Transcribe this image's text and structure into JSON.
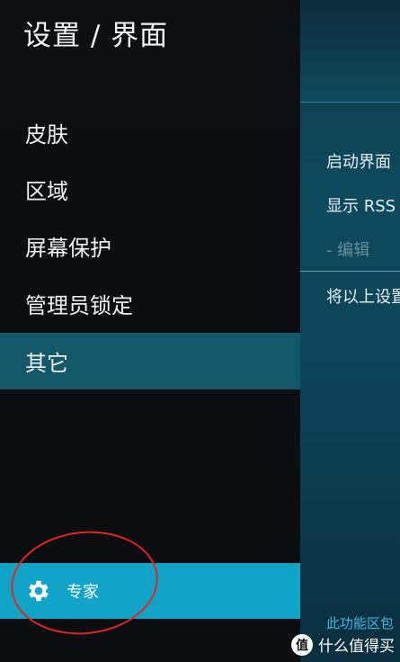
{
  "header": {
    "title": "设置 / 界面"
  },
  "menu": {
    "items": [
      {
        "label": "皮肤"
      },
      {
        "label": "区域"
      },
      {
        "label": "屏幕保护"
      },
      {
        "label": "管理员锁定"
      },
      {
        "label": "其它",
        "active": true
      }
    ]
  },
  "expert": {
    "label": "专家",
    "icon": "gear-icon"
  },
  "settings": {
    "items": [
      {
        "label": "启动界面"
      },
      {
        "label": "显示 RSS"
      },
      {
        "label": "- 编辑"
      },
      {
        "label": "将以上设置"
      }
    ],
    "footer_hint": "此功能区包"
  },
  "watermark": {
    "badge": "值",
    "text": "什么值得买"
  },
  "colors": {
    "active_item": "#14566a",
    "expert_bar": "#12a3c9",
    "annotation": "#e3261d",
    "hint_text": "#3fb8df"
  }
}
